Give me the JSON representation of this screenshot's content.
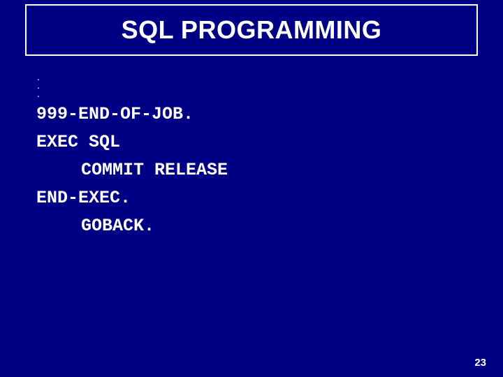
{
  "title": "SQL PROGRAMMING",
  "code": {
    "ellipsis1": ".",
    "ellipsis2": ".",
    "ellipsis3": ".",
    "line1": "999-END-OF-JOB.",
    "line2": "EXEC SQL",
    "line3": "COMMIT RELEASE",
    "line4": "END-EXEC.",
    "line5": "GOBACK."
  },
  "page_number": "23"
}
